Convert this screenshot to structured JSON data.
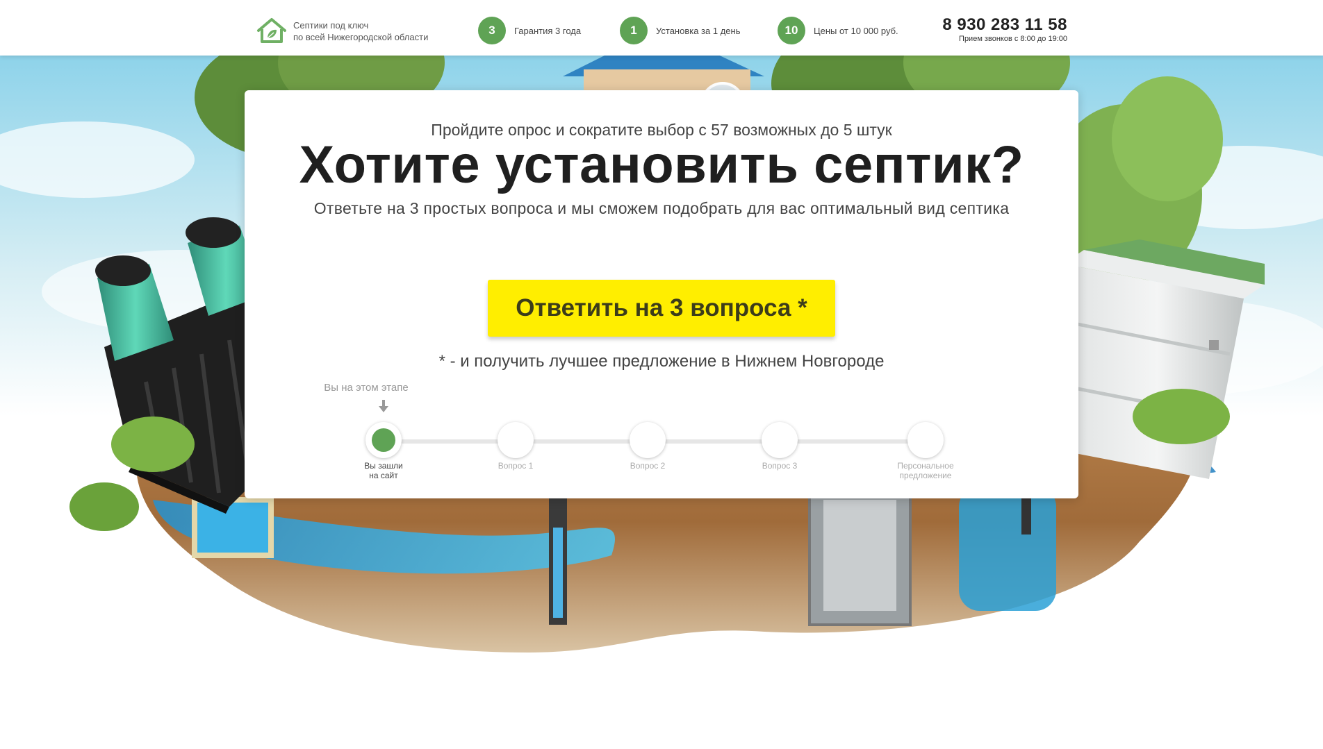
{
  "header": {
    "logo_line1": "Септики под ключ",
    "logo_line2": "по всей Нижегородской области",
    "features": [
      {
        "number": "3",
        "label": "Гарантия 3 года"
      },
      {
        "number": "1",
        "label": "Установка за 1 день"
      },
      {
        "number": "10",
        "label": "Цены от 10 000 руб."
      }
    ],
    "phone": "8 930 283 11 58",
    "hours": "Прием звонков с 8:00 до 19:00"
  },
  "card": {
    "subtitle": "Пройдите опрос и сократите выбор с 57 возможных до 5 штук",
    "title": "Хотите установить септик?",
    "lead": "Ответьте на 3 простых вопроса и мы сможем подобрать для вас оптимальный вид септика",
    "cta_label": "Ответить на 3 вопроса *",
    "note": "* - и получить лучшее предложение в Нижнем Новгороде",
    "stage_hint": "Вы на этом этапе"
  },
  "progress": {
    "current_step": 0,
    "steps": [
      {
        "label_1": "Вы зашли",
        "label_2": "на сайт"
      },
      {
        "label_1": "Вопрос 1",
        "label_2": ""
      },
      {
        "label_1": "Вопрос 2",
        "label_2": ""
      },
      {
        "label_1": "Вопрос 3",
        "label_2": ""
      },
      {
        "label_1": "Персональное",
        "label_2": "предложение"
      }
    ]
  },
  "colors": {
    "accent_green": "#5fa355",
    "cta_yellow": "#ffee00"
  },
  "icons": [
    "house-leaf-logo-icon",
    "down-arrow-icon"
  ]
}
